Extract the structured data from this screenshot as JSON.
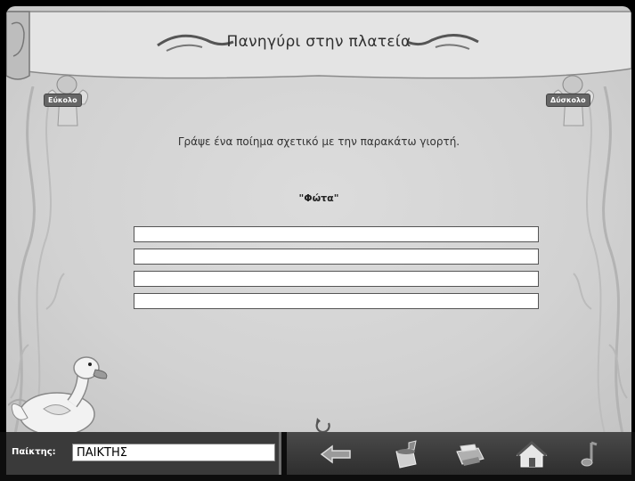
{
  "activity": {
    "title": "Πανηγύρι στην πλατεία",
    "easy_label": "Εύκολο",
    "hard_label": "Δύσκολο",
    "instruction": "Γράψε ένα ποίημα σχετικό με την παρακάτω γιορτή.",
    "topic": "\"Φώτα\""
  },
  "poem_lines": [
    "",
    "",
    "",
    ""
  ],
  "player": {
    "label": "Παίκτης:",
    "name": "ΠΑΙΚΤΗΣ"
  },
  "toolbar": {
    "icons": [
      "back-arrow-icon",
      "paint-icon",
      "printer-icon",
      "home-icon",
      "music-icon"
    ]
  },
  "colors": {
    "background": "#d4d4d4",
    "bottom_bar": "#0d0d0d"
  }
}
